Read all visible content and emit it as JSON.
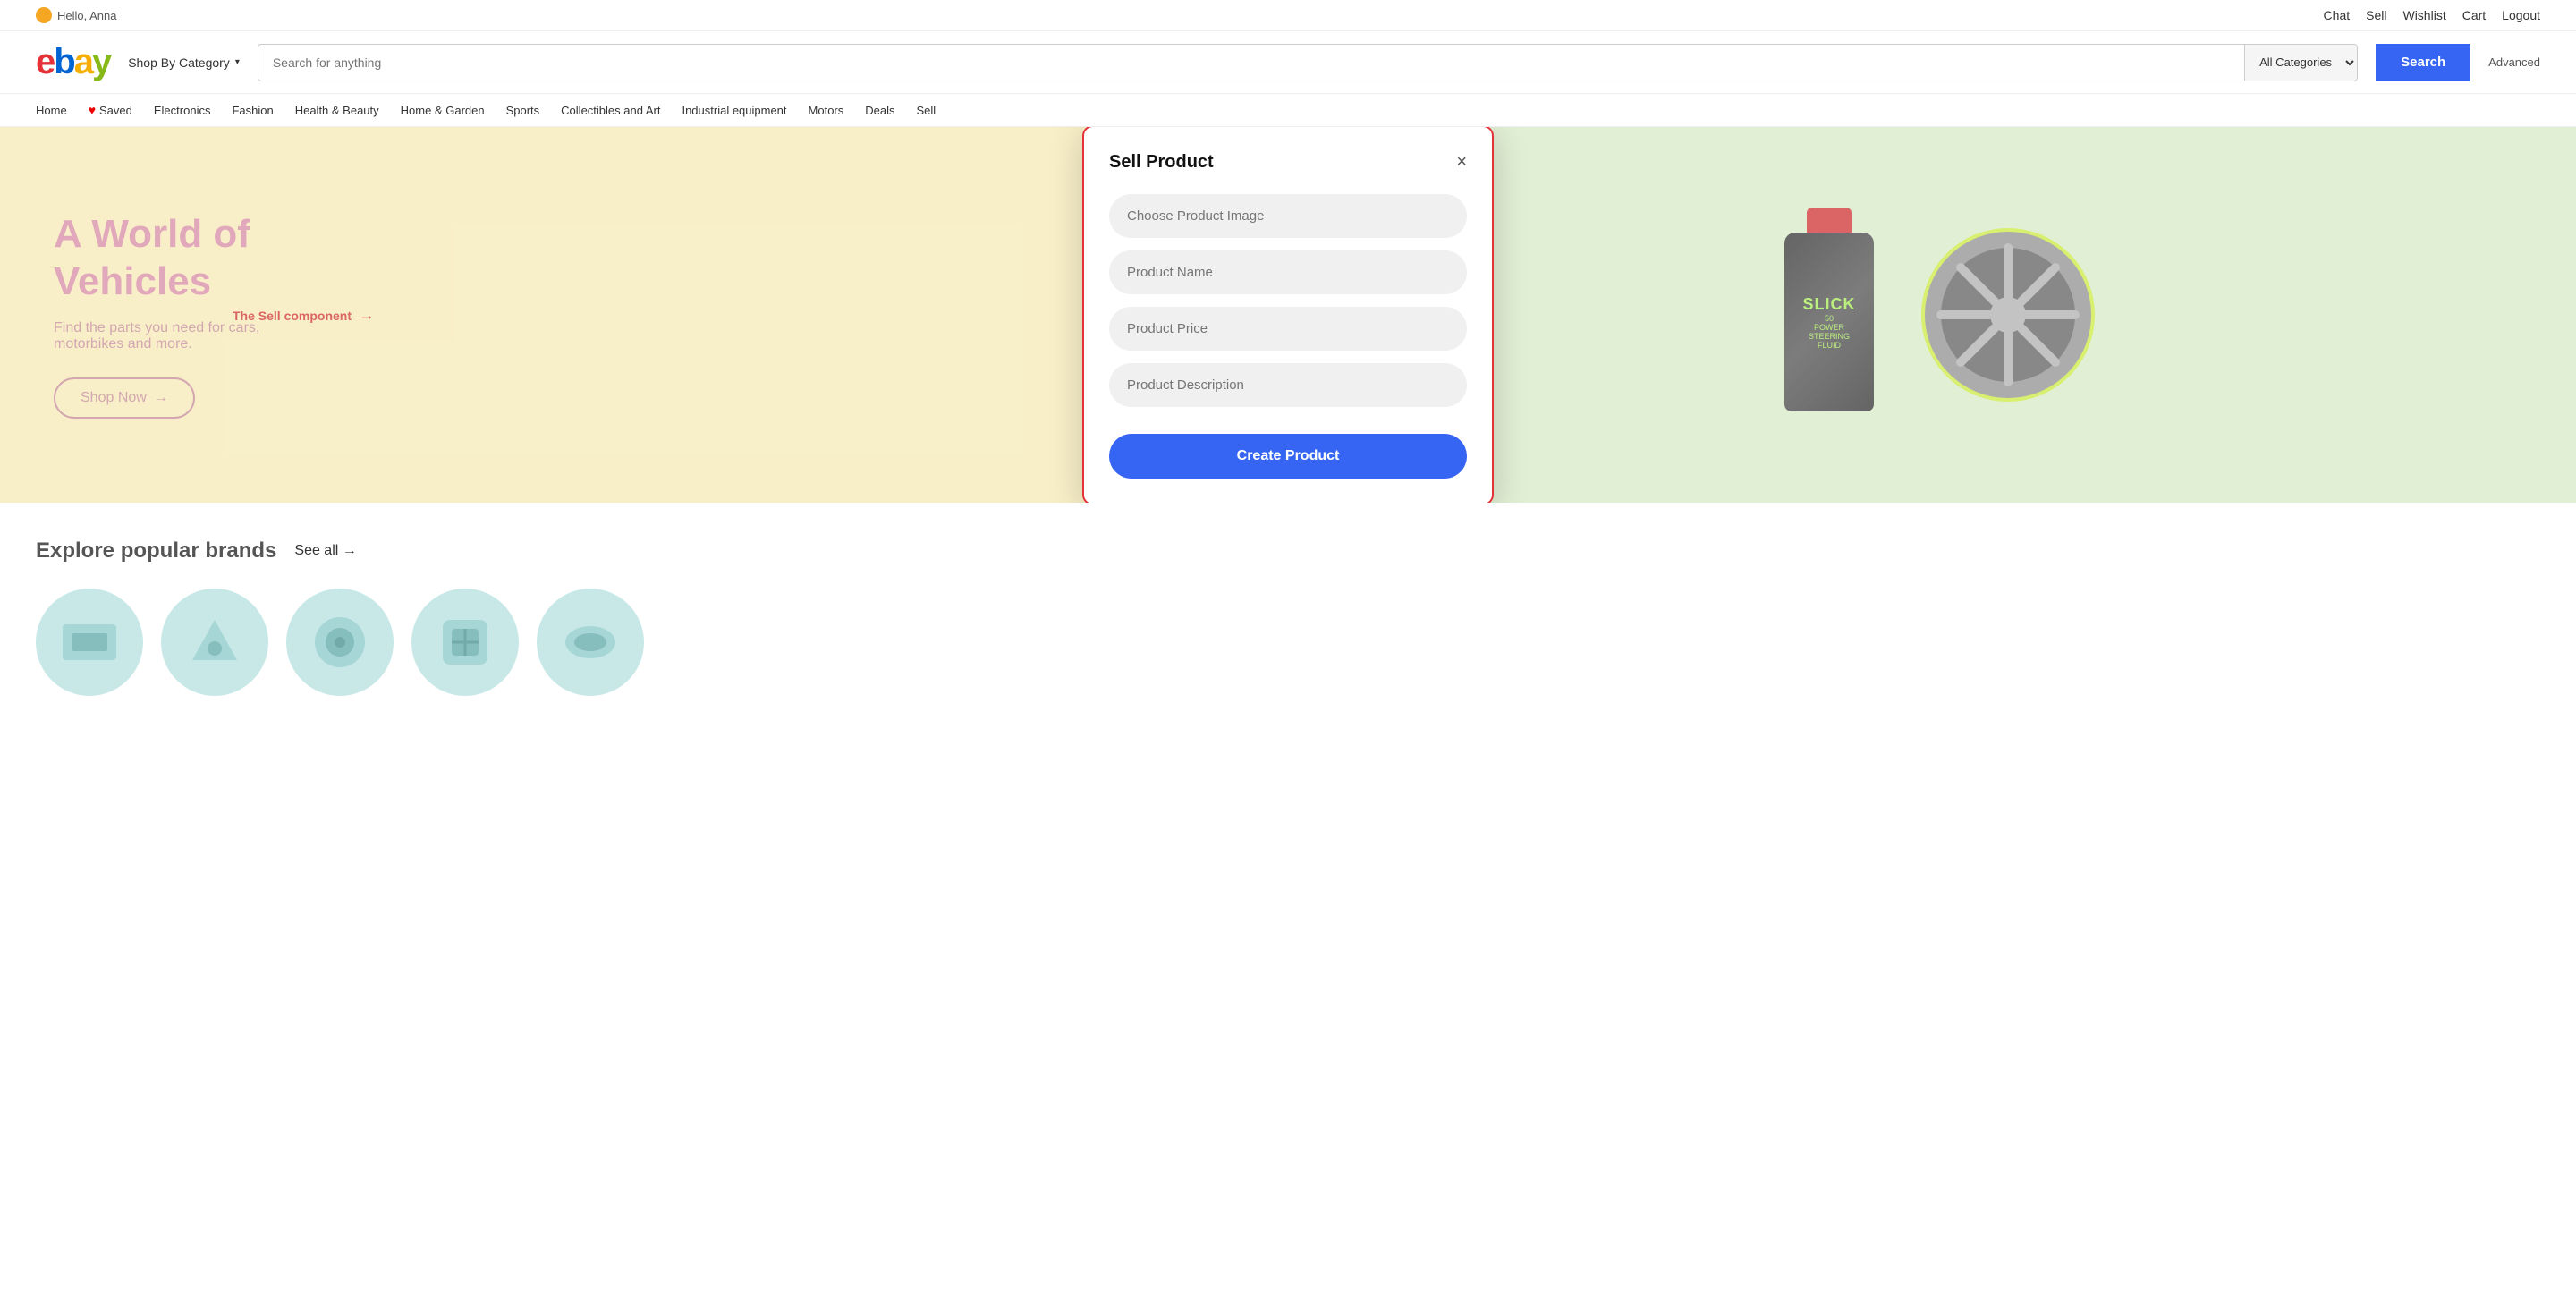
{
  "topbar": {
    "greeting": "Hello, Anna",
    "links": [
      "Chat",
      "Sell",
      "Wishlist",
      "Cart",
      "Logout"
    ]
  },
  "header": {
    "logo_letters": [
      "e",
      "b",
      "a",
      "y"
    ],
    "shop_by_category": "Shop By Category",
    "search_placeholder": "Search for anything",
    "search_category_default": "All Categories",
    "search_button": "Search",
    "advanced_link": "Advanced"
  },
  "nav": {
    "items": [
      "Home",
      "Saved",
      "Electronics",
      "Fashion",
      "Health & Beauty",
      "Home & Garden",
      "Sports",
      "Collectibles and Art",
      "Industrial equipment",
      "Motors",
      "Deals",
      "Sell"
    ]
  },
  "hero": {
    "headline_line1": "A World of",
    "headline_line2": "Vehicles",
    "subtext": "Find the parts you need for cars,\nmotorbikes and more.",
    "shop_now": "Shop Now",
    "annotation": "The Sell component"
  },
  "modal": {
    "title": "Sell Product",
    "close_label": "×",
    "fields": [
      {
        "id": "product-image",
        "placeholder": "Choose Product Image"
      },
      {
        "id": "product-name",
        "placeholder": "Product Name"
      },
      {
        "id": "product-price",
        "placeholder": "Product Price"
      },
      {
        "id": "product-description",
        "placeholder": "Product Description"
      }
    ],
    "create_button": "Create Product"
  },
  "brands": {
    "title": "Explore popular brands",
    "see_all": "See all →",
    "items": [
      {
        "id": "brand-1"
      },
      {
        "id": "brand-2"
      },
      {
        "id": "brand-3"
      },
      {
        "id": "brand-4"
      },
      {
        "id": "brand-5"
      }
    ]
  },
  "colors": {
    "logo_red": "#e53238",
    "logo_blue": "#0064d2",
    "logo_yellow": "#f5af02",
    "logo_green": "#86b817",
    "search_btn": "#3665f3",
    "modal_border": "#e53238",
    "create_btn": "#3665f3",
    "hero_bg": "#f5e9b0",
    "hero_right_bg": "#d4e8c2",
    "hero_title": "#d4829e",
    "annotation_color": "#cc2222"
  }
}
